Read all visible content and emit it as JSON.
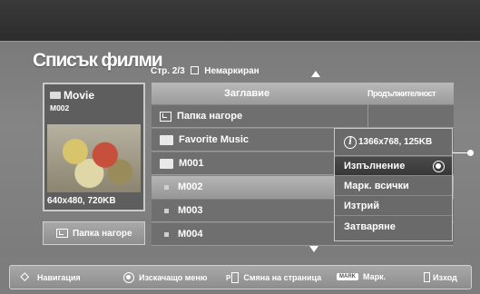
{
  "screen": {
    "title": "Списък филми",
    "page_label": "Стр. 2/3",
    "mark_filter": "Немаркиран",
    "mark_check": "☑"
  },
  "preview": {
    "title": "Movie",
    "subtitle": "M002",
    "resolution": "640x480, 720KB"
  },
  "up_button": {
    "label": "Папка нагоре"
  },
  "list": {
    "headers": {
      "title": "Заглавие",
      "duration": "Продължителност"
    },
    "rows": [
      {
        "type": "up",
        "label": "Папка нагоре"
      },
      {
        "type": "folder",
        "label": "Favorite Music"
      },
      {
        "type": "folder",
        "label": "M001"
      },
      {
        "type": "file",
        "label": "M002",
        "selected": true
      },
      {
        "type": "file",
        "label": "M003"
      },
      {
        "type": "file",
        "label": "M004"
      }
    ]
  },
  "popup": {
    "info": "1366x768, 125KB",
    "items": [
      "Изпълнение",
      "Марк. всички",
      "Изтрий",
      "Затваряне"
    ],
    "active_index": 0
  },
  "footer": {
    "navigation": "Навигация",
    "popup_menu": "Изскачащо меню",
    "page_key": "P",
    "page_change": "Смяна на страница",
    "mark_key": "MARK",
    "mark": "Марк.",
    "exit": "Изход"
  },
  "colors": {
    "background": "#7d7d7d",
    "top_bar": "#2c2c2c",
    "selected_row": "#b5b5b5",
    "active_menu_item": "#3f3f3f"
  }
}
